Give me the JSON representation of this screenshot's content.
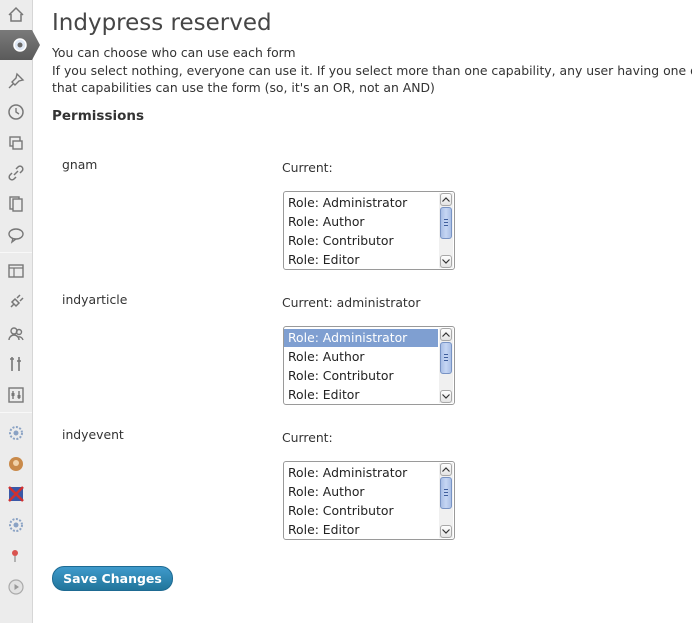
{
  "page": {
    "title": "Indypress reserved",
    "description_line1": "You can choose who can use each form",
    "description_line2": "If you select nothing, everyone can use it. If you select more than one capability, any user having one of",
    "description_line3": "that capabilities can use the form (so, it's an OR, not an AND)",
    "section_heading": "Permissions"
  },
  "forms": [
    {
      "name": "gnam",
      "current": "Current:",
      "options": [
        "Role: Administrator",
        "Role: Author",
        "Role: Contributor",
        "Role: Editor"
      ],
      "selected": []
    },
    {
      "name": "indyarticle",
      "current": "Current: administrator",
      "options": [
        "Role: Administrator",
        "Role: Author",
        "Role: Contributor",
        "Role: Editor"
      ],
      "selected": [
        "Role: Administrator"
      ]
    },
    {
      "name": "indyevent",
      "current": "Current:",
      "options": [
        "Role: Administrator",
        "Role: Author",
        "Role: Contributor",
        "Role: Editor"
      ],
      "selected": []
    }
  ],
  "save_button": "Save Changes",
  "sidebar_icons": [
    "dashboard-icon",
    "settings-icon",
    "pin-icon",
    "clock-icon",
    "media-icon",
    "link-icon",
    "pages-icon",
    "comments-icon",
    "appearance-icon",
    "plugins-icon",
    "users-icon",
    "tools-icon",
    "settings-sliders-icon",
    "gear-icon",
    "avatar-icon",
    "flag-icon",
    "gear-icon",
    "pin-red-icon",
    "play-icon"
  ],
  "colors": {
    "accent": "#21759b",
    "selected_option": "#7f9fd1",
    "sidebar_bg": "#ececec"
  }
}
